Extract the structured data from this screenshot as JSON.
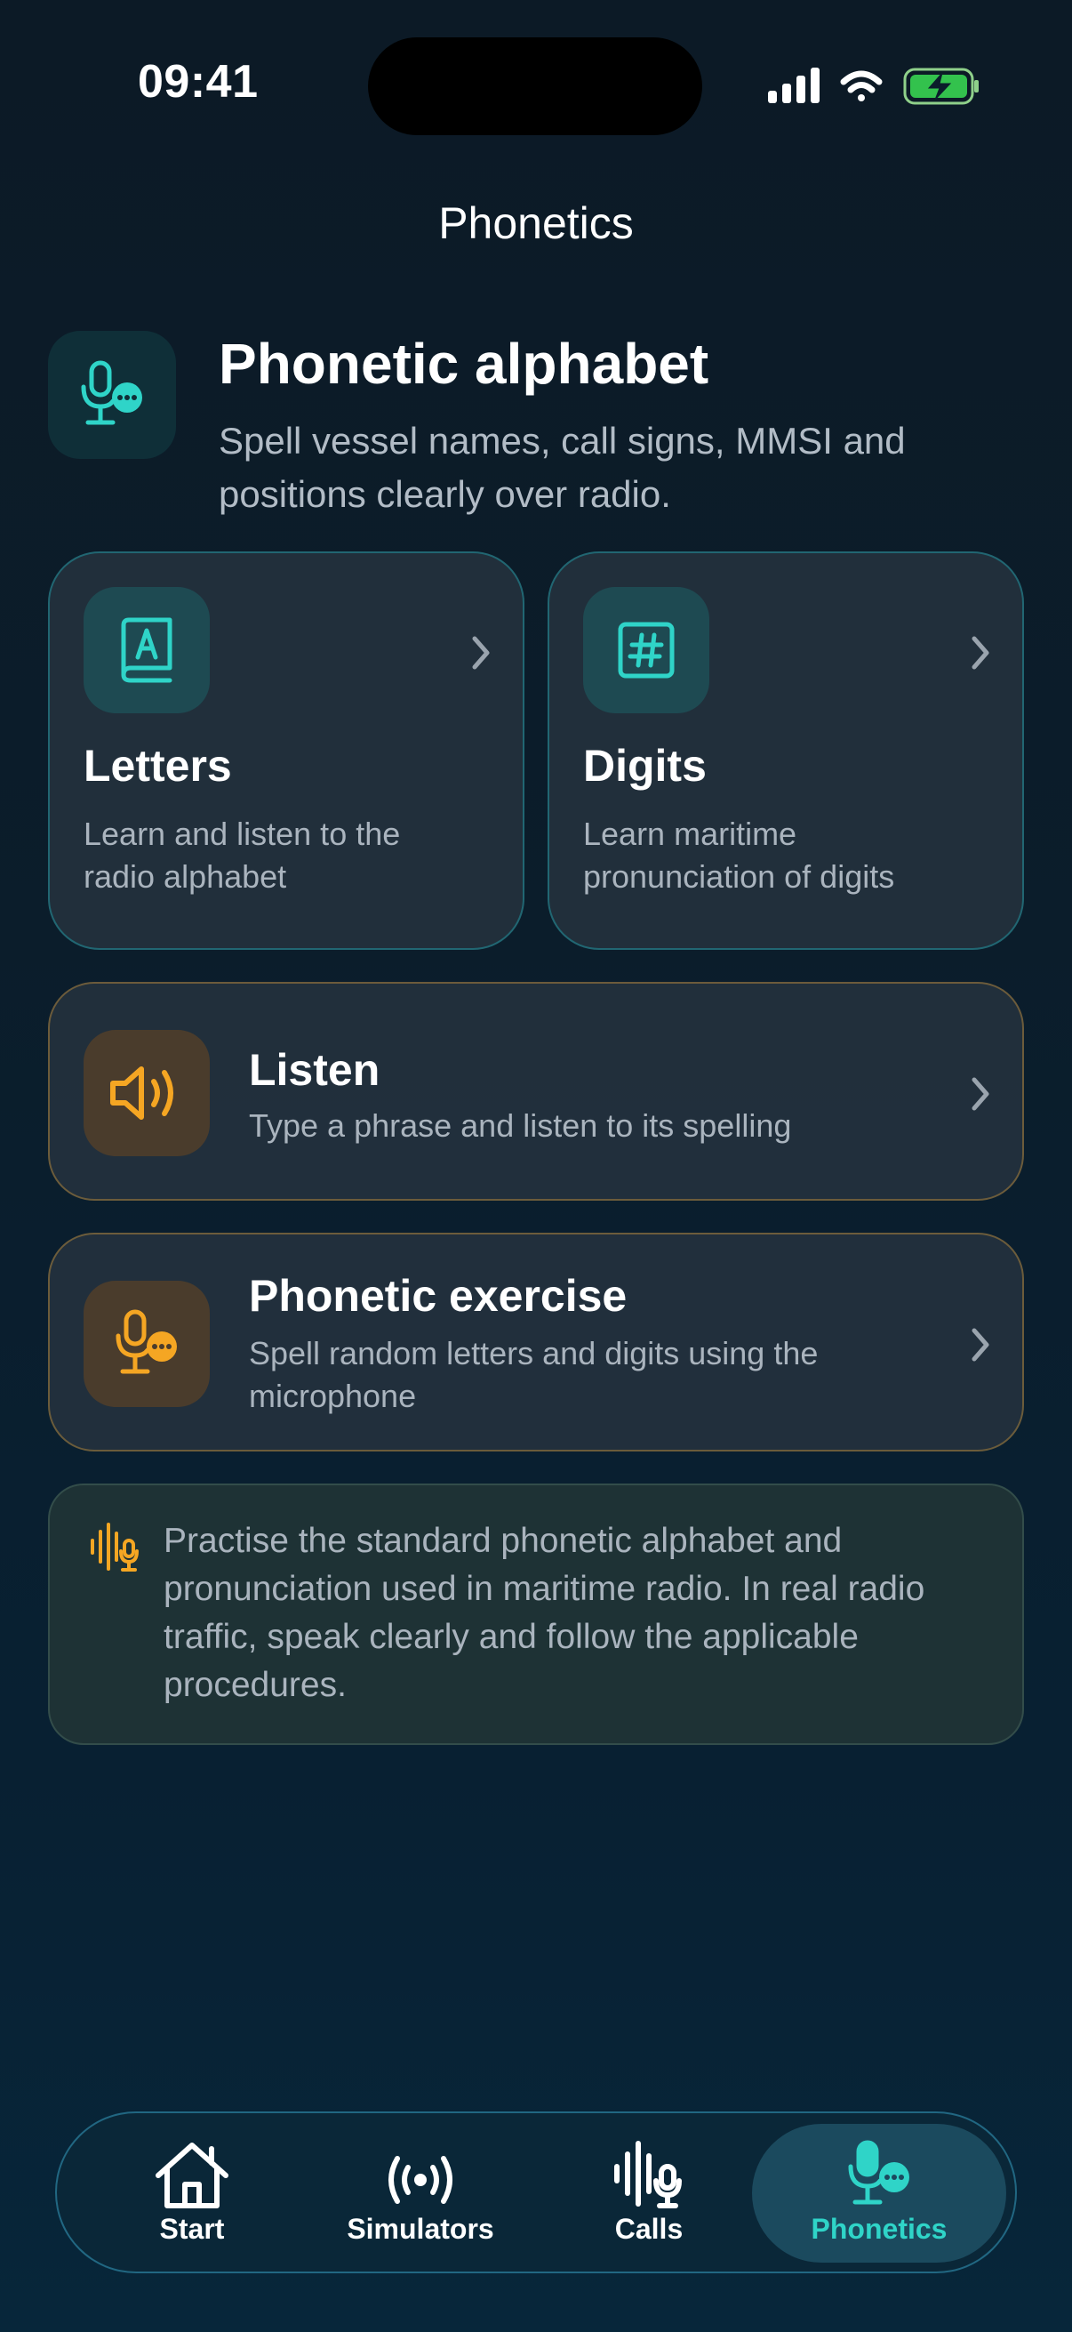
{
  "status_bar": {
    "time": "09:41"
  },
  "header": {
    "title": "Phonetics"
  },
  "hero": {
    "icon": "microphone-chat-icon",
    "title": "Phonetic alphabet",
    "subtitle": "Spell vessel names, call signs, MMSI and positions clearly over radio."
  },
  "cards": {
    "letters": {
      "icon": "alphabet-book-icon",
      "title": "Letters",
      "description": "Learn and listen to the radio alphabet"
    },
    "digits": {
      "icon": "hash-icon",
      "title": "Digits",
      "description": "Learn maritime pronunciation of digits"
    },
    "listen": {
      "icon": "speaker-icon",
      "title": "Listen",
      "description": "Type a phrase and listen to its spelling"
    },
    "exercise": {
      "icon": "microphone-chat-icon",
      "title": "Phonetic exercise",
      "description": "Spell random letters and digits using the microphone"
    }
  },
  "info": {
    "icon": "waveform-mic-icon",
    "text": "Practise the standard phonetic alphabet and pronunciation used in maritime radio. In real radio traffic, speak clearly and follow the applicable procedures."
  },
  "tabbar": {
    "tabs": [
      {
        "label": "Start",
        "icon": "house-icon"
      },
      {
        "label": "Simulators",
        "icon": "broadcast-icon"
      },
      {
        "label": "Calls",
        "icon": "waveform-mic-icon"
      },
      {
        "label": "Phonetics",
        "icon": "microphone-chat-icon"
      }
    ],
    "active": "Phonetics"
  },
  "colors": {
    "accent_teal": "#2fd4c8",
    "accent_amber": "#f5a623",
    "background": "#0b1d2b"
  }
}
